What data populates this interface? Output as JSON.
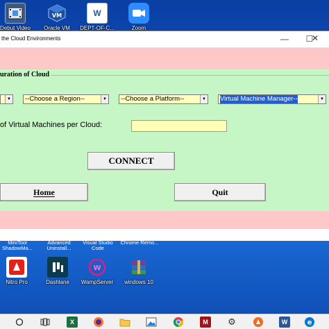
{
  "desktop": {
    "top_icons": [
      {
        "label": "Debut Video",
        "icon": "film-icon",
        "color": "#3a5a8a"
      },
      {
        "label": "Oracle VM",
        "icon": "virtualbox-icon",
        "color": "#1b4fa0"
      },
      {
        "label": "DEPT-OF-C...",
        "icon": "word-document-icon",
        "color": "#ffffff"
      },
      {
        "label": "Zoom",
        "icon": "zoom-icon",
        "color": "#2d8cff"
      }
    ],
    "partial_row_labels": [
      "MiniTool ShadowMa...",
      "Advanced Uninstall...",
      "Visual Studio Code",
      "Chrome Remo..."
    ],
    "bottom_icons": [
      {
        "label": "Nitro Pro",
        "icon": "nitro-icon",
        "color": "#e2231a"
      },
      {
        "label": "Dashlane",
        "icon": "dashlane-icon",
        "color": "#0b3b4f"
      },
      {
        "label": "WampServer",
        "icon": "wampserver-icon",
        "color": "#c0288f"
      },
      {
        "label": "windows 10",
        "icon": "winrar-icon",
        "color": "#7a3f8f"
      }
    ]
  },
  "window": {
    "title": "the Cloud Environments",
    "minimize_glyph": "—",
    "maximize_glyph": "☐",
    "close_glyph": "✕",
    "section_label": "uration of Cloud",
    "combos": [
      {
        "value": "",
        "arrow": "▼"
      },
      {
        "value": "--Choose a Region--",
        "arrow": "▼"
      },
      {
        "value": "--Choose a Platform--",
        "arrow": "▼"
      },
      {
        "value": "Virtual Machine Manager--",
        "arrow": "▼"
      }
    ],
    "vm_label": "of Virtual Machines per Cloud:",
    "vm_value": "",
    "connect_label": "CONNECT",
    "home_label": "Home",
    "quit_label": "Quit"
  },
  "taskbar": {
    "icons": [
      "task-view-icon",
      "excel-icon",
      "firefox-icon",
      "file-explorer-icon",
      "photos-icon",
      "chrome-icon",
      "mendeley-icon",
      "settings-icon",
      "avast-icon",
      "word-icon",
      "edge-icon"
    ]
  }
}
